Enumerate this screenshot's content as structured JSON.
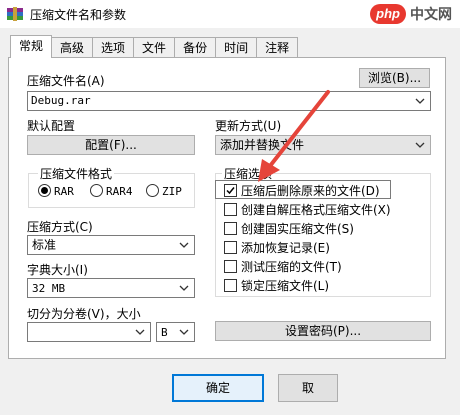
{
  "window": {
    "title": "压缩文件名和参数"
  },
  "watermark": {
    "badge": "php",
    "text": "中文网"
  },
  "tabs": [
    "常规",
    "高级",
    "选项",
    "文件",
    "备份",
    "时间",
    "注释"
  ],
  "archive_name": {
    "label": "压缩文件名(A)",
    "value": "Debug.rar",
    "browse_label": "浏览(B)..."
  },
  "default_profile": {
    "label": "默认配置",
    "button_label": "配置(F)..."
  },
  "update_mode": {
    "label": "更新方式(U)",
    "value": "添加并替换文件"
  },
  "archive_format": {
    "label": "压缩文件格式",
    "options": [
      "RAR",
      "RAR4",
      "ZIP"
    ],
    "selected": "RAR"
  },
  "compression_method": {
    "label": "压缩方式(C)",
    "value": "标准"
  },
  "dictionary_size": {
    "label": "字典大小(I)",
    "value": "32 MB"
  },
  "split": {
    "label": "切分为分卷(V)，大小",
    "value": "",
    "unit": "B"
  },
  "archive_options": {
    "label": "压缩选项",
    "items": [
      {
        "label": "压缩后删除原来的文件(D)",
        "checked": true
      },
      {
        "label": "创建自解压格式压缩文件(X)",
        "checked": false
      },
      {
        "label": "创建固实压缩文件(S)",
        "checked": false
      },
      {
        "label": "添加恢复记录(E)",
        "checked": false
      },
      {
        "label": "测试压缩的文件(T)",
        "checked": false
      },
      {
        "label": "锁定压缩文件(L)",
        "checked": false
      }
    ]
  },
  "set_password_label": "设置密码(P)...",
  "footer": {
    "ok_label": "确定",
    "cancel_label": "取"
  },
  "colors": {
    "accent": "#0078d7",
    "arrow": "#e5443a",
    "watermark": "#e8382f"
  }
}
